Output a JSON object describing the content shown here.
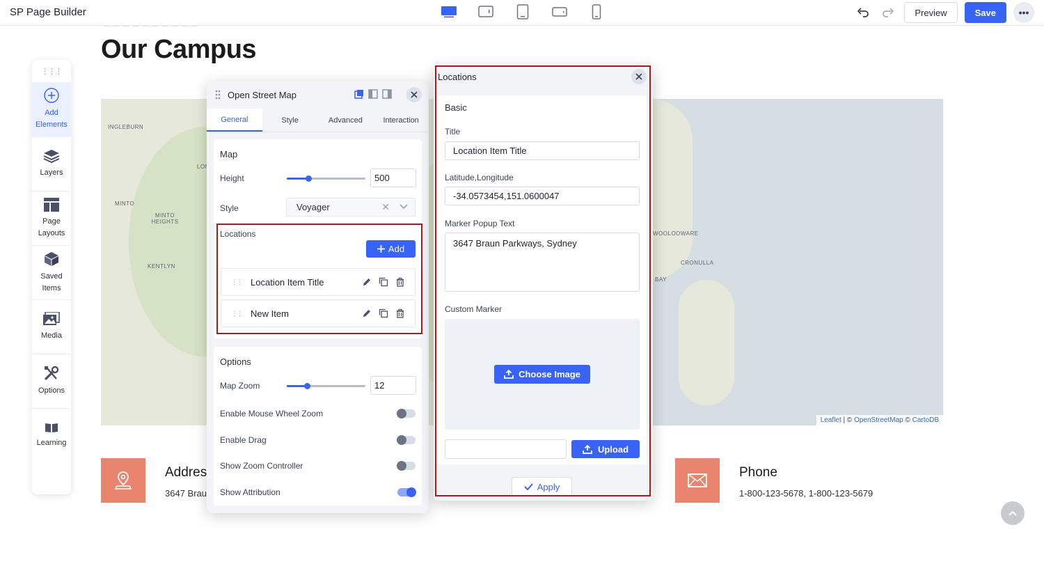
{
  "app": {
    "title": "SP Page Builder"
  },
  "toolbar": {
    "devices": [
      "desktop-icon",
      "tablet-landscape-icon",
      "tablet-icon",
      "mobile-landscape-icon",
      "mobile-icon"
    ],
    "preview_label": "Preview",
    "save_label": "Save",
    "more_label": "•••"
  },
  "page": {
    "heading": "Our Campus",
    "map_labels": [
      "INGLEBURN",
      "MINTO",
      "MINTO HEIGHTS",
      "KENTLYN",
      "LON",
      "WOOLOOWARE",
      "CRONULLA",
      "BAY"
    ],
    "attribution": {
      "leaflet": "Leaflet",
      "sep1": " | © ",
      "osm": "OpenStreetMap",
      "sep2": " © ",
      "carto": "CartoDB"
    },
    "address": {
      "title": "Addres",
      "text": "3647 Brau"
    },
    "phone": {
      "title": "Phone",
      "text": "1-800-123-5678, 1-800-123-5679"
    }
  },
  "sidebar": {
    "grip": "⋮⋮⋮",
    "items": [
      {
        "label": "Add Elements",
        "icon": "plus-circle-icon"
      },
      {
        "label": "Layers",
        "icon": "layers-icon"
      },
      {
        "label": "Page Layouts",
        "icon": "layout-icon"
      },
      {
        "label": "Saved Items",
        "icon": "box-icon"
      },
      {
        "label": "Media",
        "icon": "image-icon"
      },
      {
        "label": "Options",
        "icon": "tools-icon"
      },
      {
        "label": "Learning",
        "icon": "book-icon"
      }
    ]
  },
  "osm_panel": {
    "title": "Open Street Map",
    "tabs": [
      "General",
      "Style",
      "Advanced",
      "Interaction"
    ],
    "active_tab": "General",
    "map_section": {
      "title": "Map",
      "height_label": "Height",
      "height_value": "500",
      "height_fraction": 0.27,
      "style_label": "Style",
      "style_value": "Voyager"
    },
    "locations": {
      "title": "Locations",
      "add_label": "Add",
      "items": [
        "Location Item Title",
        "New Item"
      ]
    },
    "options": {
      "title": "Options",
      "zoom_label": "Map Zoom",
      "zoom_value": "12",
      "zoom_fraction": 0.26,
      "toggles": [
        {
          "label": "Enable Mouse Wheel Zoom",
          "on": false
        },
        {
          "label": "Enable Drag",
          "on": false
        },
        {
          "label": "Show Zoom Controller",
          "on": false
        },
        {
          "label": "Show Attribution",
          "on": true
        }
      ]
    }
  },
  "locations_panel": {
    "title": "Locations",
    "section": "Basic",
    "title_label": "Title",
    "title_value": "Location Item Title",
    "latlng_label": "Latitude,Longitude",
    "latlng_value": "-34.0573454,151.0600047",
    "popup_label": "Marker Popup Text",
    "popup_value": "3647 Braun Parkways, Sydney",
    "marker_label": "Custom Marker",
    "choose_label": "Choose Image",
    "upload_label": "Upload",
    "apply_label": "Apply"
  },
  "colors": {
    "accent": "#3863f6",
    "highlight_border": "#a21d1d",
    "info_icon": "#e9846e"
  }
}
